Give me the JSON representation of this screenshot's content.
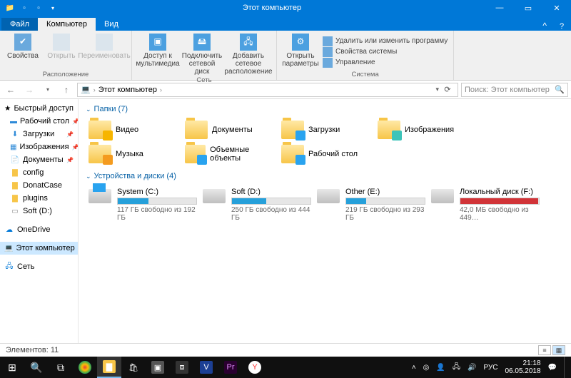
{
  "window": {
    "title": "Этот компьютер",
    "minimize": "—",
    "maximize": "▭",
    "close": "✕"
  },
  "tabs": {
    "file": "Файл",
    "computer": "Компьютер",
    "view": "Вид"
  },
  "ribbon": {
    "props": "Свойства",
    "open": "Открыть",
    "rename": "Переименовать",
    "group_location": "Расположение",
    "media": "Доступ к мультимедиа",
    "mapdrive": "Подключить сетевой диск",
    "addnet": "Добавить сетевое расположение",
    "group_network": "Сеть",
    "settings": "Открыть параметры",
    "uninstall": "Удалить или изменить программу",
    "sysprops": "Свойства системы",
    "manage": "Управление",
    "group_system": "Система"
  },
  "nav": {
    "back": "←",
    "fwd": "→",
    "up": "↑",
    "pc_icon": "💻",
    "crumb": "Этот компьютер",
    "refresh": "⟳",
    "search_placeholder": "Поиск: Этот компьютер"
  },
  "sidebar": {
    "quick": "Быстрый доступ",
    "desktop": "Рабочий стол",
    "downloads": "Загрузки",
    "pictures": "Изображения",
    "documents": "Документы",
    "config": "config",
    "donatcase": "DonatCase",
    "plugins": "plugins",
    "softd": "Soft (D:)",
    "onedrive": "OneDrive",
    "thispc": "Этот компьютер",
    "network": "Сеть"
  },
  "sections": {
    "folders": "Папки (7)",
    "drives": "Устройства и диски (4)"
  },
  "folders": {
    "videos": "Видео",
    "documents": "Документы",
    "downloads": "Загрузки",
    "pictures": "Изображения",
    "music": "Музыка",
    "objects3d": "Объемные объекты",
    "desktop": "Рабочий стол"
  },
  "drives": [
    {
      "name": "System (C:)",
      "free": "117 ГБ свободно из 192 ГБ",
      "fill": 39,
      "windows": true,
      "color": "blue"
    },
    {
      "name": "Soft (D:)",
      "free": "250 ГБ свободно из 444 ГБ",
      "fill": 44,
      "windows": false,
      "color": "blue"
    },
    {
      "name": "Other (E:)",
      "free": "219 ГБ свободно из 293 ГБ",
      "fill": 25,
      "windows": false,
      "color": "blue"
    },
    {
      "name": "Локальный диск (F:)",
      "free": "42,0 МБ свободно из 449…",
      "fill": 99,
      "windows": false,
      "color": "red"
    }
  ],
  "status": {
    "count": "Элементов: 11"
  },
  "tray": {
    "lang": "РУС",
    "time": "21:18",
    "date": "06.05.2018"
  }
}
